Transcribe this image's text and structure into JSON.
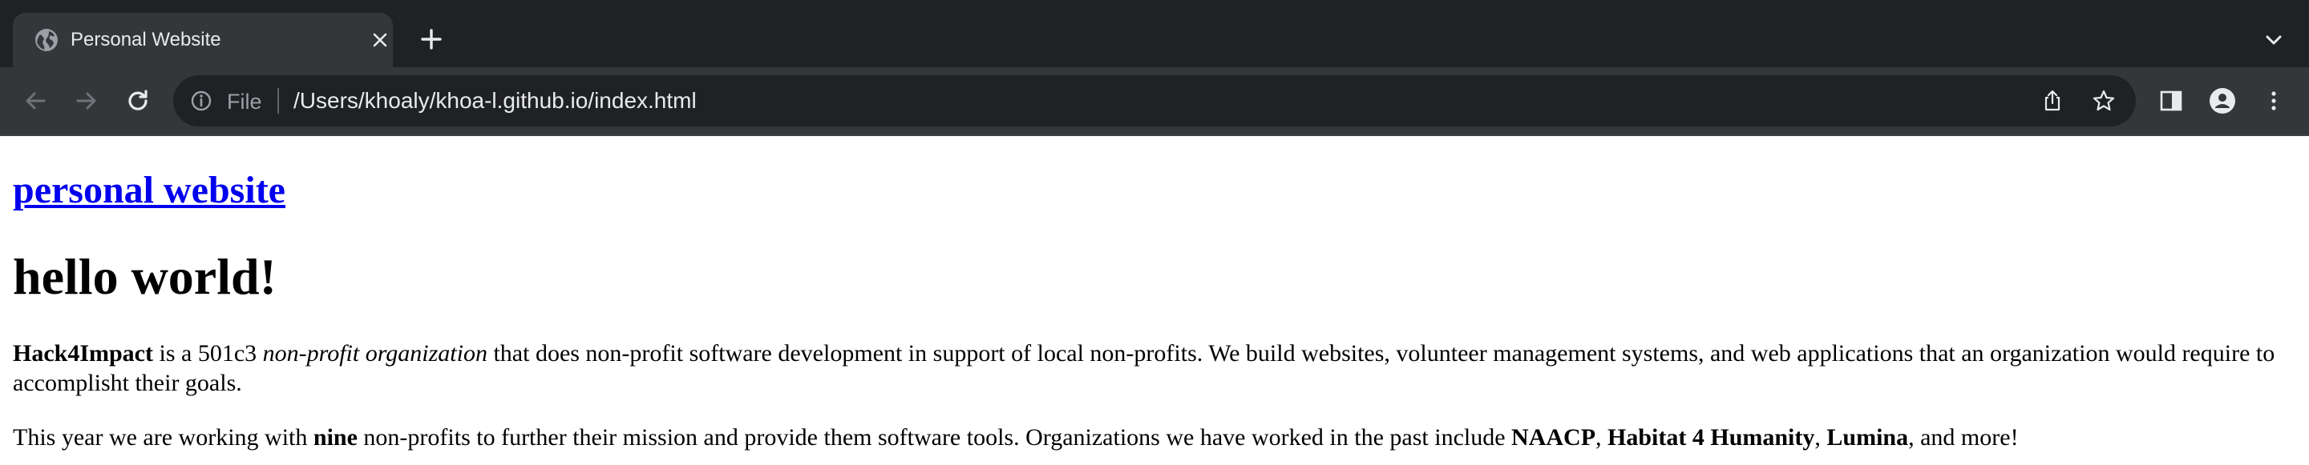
{
  "browser": {
    "tab": {
      "title": "Personal Website",
      "favicon_icon": "globe-icon",
      "close_icon": "close-icon"
    },
    "new_tab_icon": "plus-icon",
    "tab_search_icon": "chevron-down-icon",
    "toolbar": {
      "back_icon": "back-arrow-icon",
      "forward_icon": "forward-arrow-icon",
      "reload_icon": "reload-icon",
      "site_info_icon": "info-icon",
      "scheme_label": "File",
      "url": "/Users/khoaly/khoa-l.github.io/index.html",
      "share_icon": "share-icon",
      "bookmark_icon": "star-icon",
      "side_panel_icon": "side-panel-icon",
      "profile_icon": "profile-icon",
      "menu_icon": "kebab-menu-icon"
    },
    "colors": {
      "tabbar_bg": "#202124",
      "toolbar_bg": "#35363a",
      "omnibox_bg": "#202124",
      "chrome_text": "#e8eaed",
      "link": "#0000ee"
    }
  },
  "page": {
    "site_link": "personal website",
    "heading": "hello world!",
    "para1": {
      "org_name": "Hack4Impact",
      "text_a": " is a 501c3 ",
      "org_type": "non-profit organization",
      "text_b": " that does non-profit software development in support of local non-profits. We build websites, volunteer management systems, and web applications that an organization would require to accomplisht their goals."
    },
    "para2": {
      "text_a": "This year we are working with ",
      "count": "nine",
      "text_b": " non-profits to further their mission and provide them software tools. Organizations we have worked in the past include ",
      "org1": "NAACP",
      "sep1": ", ",
      "org2": "Habitat 4 Humanity",
      "sep2": ", ",
      "org3": "Lumina",
      "text_c": ", and more!"
    }
  }
}
